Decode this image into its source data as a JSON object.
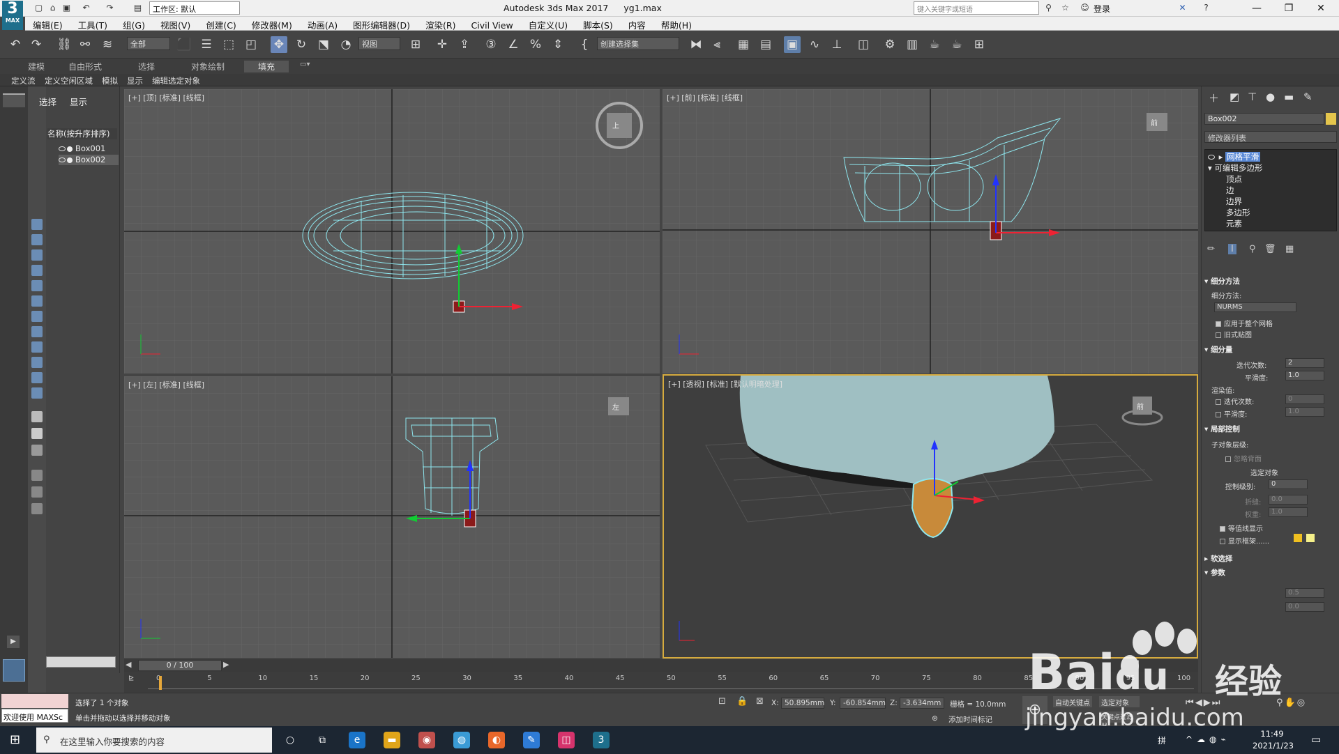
{
  "app": {
    "logo_top": "3",
    "logo_bottom": "MAX",
    "title": "Autodesk 3ds Max 2017",
    "filename": "yg1.max",
    "workspace": "工作区: 默认",
    "search_placeholder": "键入关键字或短语",
    "login": "登录"
  },
  "menu": [
    "编辑(E)",
    "工具(T)",
    "组(G)",
    "视图(V)",
    "创建(C)",
    "修改器(M)",
    "动画(A)",
    "图形编辑器(D)",
    "渲染(R)",
    "Civil View",
    "自定义(U)",
    "脚本(S)",
    "内容",
    "帮助(H)"
  ],
  "toolbar": {
    "filter": "全部",
    "ref_coord": "视图",
    "selection_set": "创建选择集"
  },
  "ribbon": {
    "tabs": [
      "建模",
      "自由形式",
      "选择",
      "对象绘制",
      "填充"
    ],
    "sub": [
      "定义流",
      "定义空闲区域",
      "模拟",
      "显示",
      "编辑选定对象"
    ]
  },
  "scene": {
    "tab_select": "选择",
    "tab_display": "显示",
    "header": "名称(按升序排序)",
    "objects": [
      "Box001",
      "Box002"
    ]
  },
  "viewports": {
    "top": "[+] [顶] [标准] [线框]",
    "front": "[+] [前] [标准] [线框]",
    "left": "[+] [左] [标准] [线框]",
    "persp": "[+] [透视] [标准] [默认明暗处理]",
    "cube_top": "上",
    "cube_front": "前",
    "cube_left": "左",
    "cube_persp": "前"
  },
  "cmd": {
    "object_name": "Box002",
    "modifier_list": "修改器列表",
    "stack": [
      "网格平滑",
      "可编辑多边形",
      "顶点",
      "边",
      "边界",
      "多边形",
      "元素"
    ],
    "sec_subdiv": "细分方法",
    "subdiv_method_label": "细分方法:",
    "subdiv_method": "NURMS",
    "apply_whole": "应用于整个网格",
    "old_map": "旧式贴图",
    "sec_amount": "细分量",
    "iterations_label": "迭代次数:",
    "iterations": "2",
    "smooth_label": "平滑度:",
    "smooth": "1.0",
    "render_label": "渲染值:",
    "r_iter_label": "迭代次数:",
    "r_iter": "0",
    "r_smooth_label": "平滑度:",
    "r_smooth": "1.0",
    "sec_local": "局部控制",
    "sublevel_label": "子对象层级:",
    "ignore_back": "忽略背面",
    "select_obj": "选定对象",
    "control_label": "控制级别:",
    "control": "0",
    "crease_label": "折缝:",
    "crease": "0.0",
    "weight_label": "权重:",
    "weight": "1.0",
    "isoline": "等值线显示",
    "show_cage": "显示框架......",
    "sec_soft": "软选择",
    "sec_params": "参数",
    "param_a": "0.5",
    "param_b": "0.0"
  },
  "timeline": {
    "frame": "0 / 100",
    "ticks": [
      "0",
      "5",
      "10",
      "15",
      "20",
      "25",
      "30",
      "35",
      "40",
      "45",
      "50",
      "55",
      "60",
      "65",
      "70",
      "75",
      "80",
      "85",
      "90",
      "95",
      "100"
    ]
  },
  "status": {
    "selected": "选择了 1 个对象",
    "hint": "单击并拖动以选择并移动对象",
    "welcome": "欢迎使用 MAXSc",
    "x_label": "X:",
    "x": "50.895mm",
    "y_label": "Y:",
    "y": "-60.854mm",
    "z_label": "Z:",
    "z": "-3.634mm",
    "grid": "栅格 = 10.0mm",
    "add_tag": "添加时间标记",
    "auto_key": "自动关键点",
    "set_key": "选定对象",
    "key_filter": "关键点过滤器..."
  },
  "taskbar": {
    "search": "在这里输入你要搜索的内容",
    "time": "11:49",
    "date": "2021/1/23"
  },
  "watermark": {
    "brand": "Bai",
    "brand2": "du",
    "jingyan": "经验",
    "url": "jingyan.baidu.com"
  }
}
